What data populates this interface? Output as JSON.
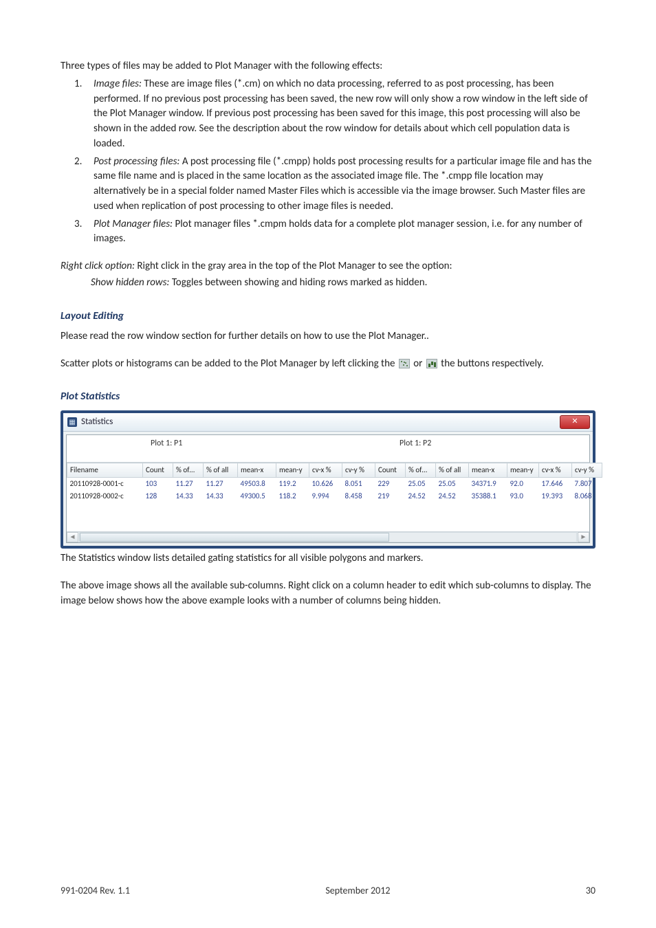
{
  "intro": "Three types of files may be added to Plot Manager with the following effects:",
  "list": [
    {
      "num": "1.",
      "label": "Image files:",
      "body": " These are image files (*.cm) on which no data processing, referred to as post processing, has been performed. If no previous post processing has been saved, the new row will only show a row window in the left side of the Plot Manager window. If previous post processing has been saved for this image, this post processing will also be shown in the added row. See the description about the row window for details about which cell population data is loaded."
    },
    {
      "num": "2.",
      "label": "Post processing files:",
      "body": " A post processing file (*.cmpp) holds post processing results for a particular image file and has the same file name and is placed in the same location as the associated image file. The *.cmpp file location may alternatively be in a special folder named Master Files which is accessible via the image browser. Such Master files are used when replication of post processing to other image files is needed."
    },
    {
      "num": "3.",
      "label": "Plot Manager files:",
      "body": " Plot manager files *.cmpm holds data for a complete plot manager session, i.e. for any number of images."
    }
  ],
  "rco_label": "Right click option:",
  "rco_body": " Right click in the gray area in the top of the Plot Manager to see the option:",
  "shr_label": "Show hidden rows:",
  "shr_body": " Toggles between showing and hiding rows marked as hidden.",
  "heading_layout": "Layout Editing",
  "layout_p1": "Please read the row window section for further details on how to use the Plot Manager.",
  "scatter_pre": "Scatter plots or histograms can be added to the Plot Manager by left clicking the ",
  "scatter_mid": " or ",
  "scatter_post": " the buttons respectively.",
  "heading_stats": "Plot Statistics",
  "window": {
    "title": "Statistics",
    "close": "✕",
    "group1": "Plot 1: P1",
    "group2": "Plot 1: P2",
    "columns": [
      "Filename",
      "Count",
      "% of…",
      "% of all",
      "mean-x",
      "mean-y",
      "cv-x %",
      "cv-y %",
      "Count",
      "% of…",
      "% of all",
      "mean-x",
      "mean-y",
      "cv-x %",
      "cv-y %"
    ],
    "rows": [
      [
        "20110928-0001-c",
        "103",
        "11.27",
        "11.27",
        "49503.8",
        "119.2",
        "10.626",
        "8.051",
        "229",
        "25.05",
        "25.05",
        "34371.9",
        "92.0",
        "17.646",
        "7.807"
      ],
      [
        "20110928-0002-c",
        "128",
        "14.33",
        "14.33",
        "49300.5",
        "118.2",
        "9.994",
        "8.458",
        "219",
        "24.52",
        "24.52",
        "35388.1",
        "93.0",
        "19.393",
        "8.068"
      ]
    ]
  },
  "caption1": "The Statistics window lists detailed gating statistics for all visible polygons and markers.",
  "caption2": "The above image shows all the available sub-columns. Right click on a column header to edit which sub-columns to display. The image below shows how the above example looks with a number of columns being hidden.",
  "footer": {
    "left": "991-0204 Rev. 1.1",
    "center": "September 2012",
    "right": "30"
  },
  "chart_data": {
    "type": "table",
    "title": "Statistics",
    "groups": [
      "Plot 1: P1",
      "Plot 1: P2"
    ],
    "columns": [
      "Filename",
      "Count",
      "% of…",
      "% of all",
      "mean-x",
      "mean-y",
      "cv-x %",
      "cv-y %",
      "Count",
      "% of…",
      "% of all",
      "mean-x",
      "mean-y",
      "cv-x %",
      "cv-y %"
    ],
    "rows": [
      {
        "Filename": "20110928-0001-c",
        "P1": {
          "Count": 103,
          "% of…": 11.27,
          "% of all": 11.27,
          "mean-x": 49503.8,
          "mean-y": 119.2,
          "cv-x %": 10.626,
          "cv-y %": 8.051
        },
        "P2": {
          "Count": 229,
          "% of…": 25.05,
          "% of all": 25.05,
          "mean-x": 34371.9,
          "mean-y": 92.0,
          "cv-x %": 17.646,
          "cv-y %": 7.807
        }
      },
      {
        "Filename": "20110928-0002-c",
        "P1": {
          "Count": 128,
          "% of…": 14.33,
          "% of all": 14.33,
          "mean-x": 49300.5,
          "mean-y": 118.2,
          "cv-x %": 9.994,
          "cv-y %": 8.458
        },
        "P2": {
          "Count": 219,
          "% of…": 24.52,
          "% of all": 24.52,
          "mean-x": 35388.1,
          "mean-y": 93.0,
          "cv-x %": 19.393,
          "cv-y %": 8.068
        }
      }
    ]
  }
}
